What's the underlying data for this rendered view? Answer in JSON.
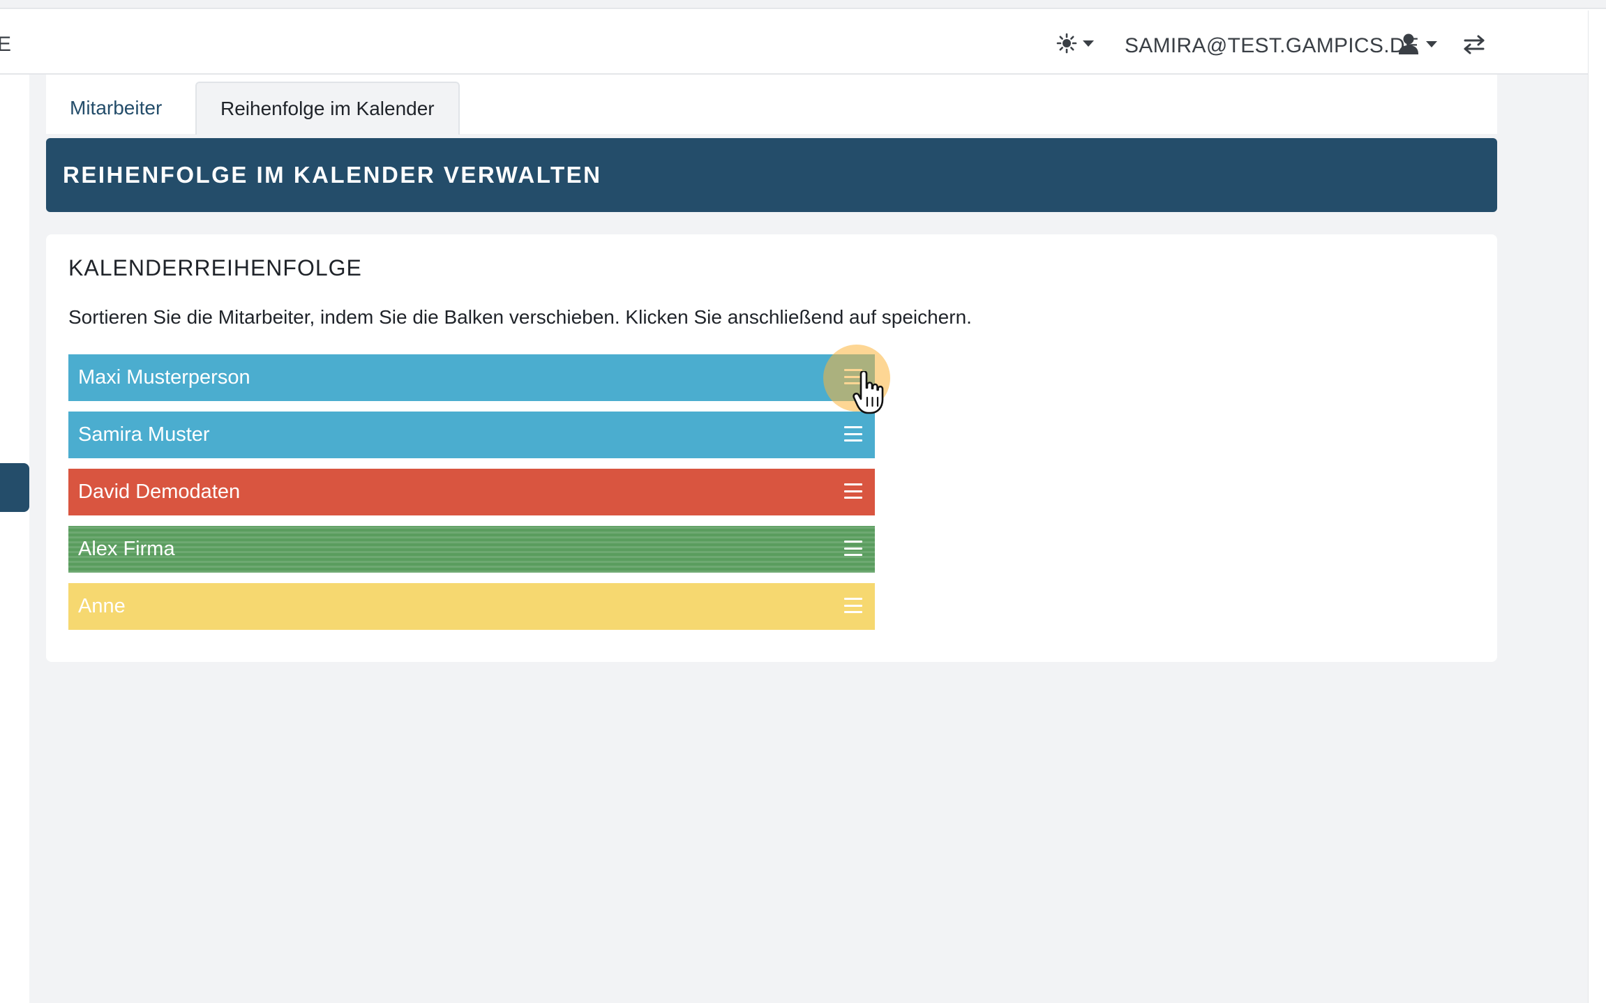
{
  "topbar": {
    "left_fragment": "E",
    "user_email": "SAMIRA@TEST.GAMPICS.DE"
  },
  "tabs": [
    {
      "label": "Mitarbeiter",
      "active": false
    },
    {
      "label": "Reihenfolge im Kalender",
      "active": true
    }
  ],
  "header": {
    "title": "REIHENFOLGE IM KALENDER VERWALTEN"
  },
  "card": {
    "title": "KALENDERREIHENFOLGE",
    "description": "Sortieren Sie die Mitarbeiter, indem Sie die Balken verschieben. Klicken Sie anschließend auf speichern."
  },
  "employees": [
    {
      "name": "Maxi Musterperson",
      "color": "#4badcf",
      "pattern": "solid"
    },
    {
      "name": "Samira Muster",
      "color": "#4badcf",
      "pattern": "solid"
    },
    {
      "name": "David Demodaten",
      "color": "#d95540",
      "pattern": "solid"
    },
    {
      "name": "Alex Firma",
      "color": "#5a9d5e",
      "pattern": "striped"
    },
    {
      "name": "Anne",
      "color": "#f6d870",
      "pattern": "solid"
    }
  ],
  "colors": {
    "brand_dark": "#244d6a",
    "background": "#f2f3f5",
    "cursor_highlight": "#fcb43c"
  }
}
